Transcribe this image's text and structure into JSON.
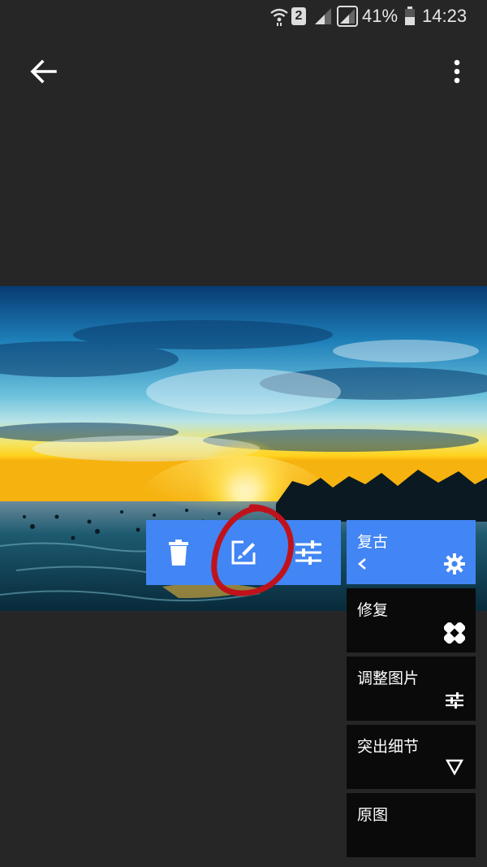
{
  "status_bar": {
    "sim_label": "2",
    "battery": "41%",
    "time": "14:23"
  },
  "toolbar": {
    "buttons": [
      {
        "icon": "delete-icon"
      },
      {
        "icon": "edit-brush-icon"
      },
      {
        "icon": "adjust-sliders-icon"
      }
    ]
  },
  "filters": [
    {
      "label": "复古",
      "state": "active"
    },
    {
      "label": "修复"
    },
    {
      "label": "调整图片"
    },
    {
      "label": "突出细节"
    },
    {
      "label": "原图"
    }
  ],
  "colors": {
    "accent": "#4285f4",
    "background": "#262626",
    "panel": "#0a0a0a",
    "annotation": "#c0121b"
  }
}
